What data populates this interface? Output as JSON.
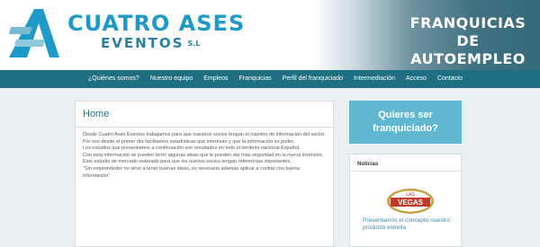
{
  "header": {
    "logo_main": "CUATRO ASES",
    "logo_sub": "EVENTOS",
    "logo_suffix": "S.L",
    "tagline_line1": "FRANQUICIAS DE",
    "tagline_line2": "AUTOEMPLEO"
  },
  "nav": {
    "items": [
      {
        "label": "¿Quiénes somos?"
      },
      {
        "label": "Nuestro equipo"
      },
      {
        "label": "Empleos"
      },
      {
        "label": "Franquicias"
      },
      {
        "label": "Perfil del franquiciado"
      },
      {
        "label": "Intermediación"
      },
      {
        "label": "Acceso"
      },
      {
        "label": "Contacto"
      }
    ]
  },
  "main": {
    "title": "Home",
    "paragraphs": [
      "Desde Cuatro Ases Eventos trabajamos para que nuestros socios tengan el máximo de información del sector.",
      "Por eso desde el primer día facilitamos estadísticas que interesan y que la información es poder.",
      "Los estudios que presentamos a continuación son resultados en todo el territorio nacional Español.",
      "Con esta información se pueden tener algunas ideas que le pueden dar más seguridad en la nueva inversión.",
      "Este estudio de mercado realizado para que los nuevos socios tengan referencias importantes.",
      "\"Sin emprendedor no sirve a tener buenas ideas, es necesario además aplicar a confiar con buena información\""
    ]
  },
  "sidebar": {
    "cta_line1": "Quieres ser",
    "cta_line2": "franquiciado?",
    "news_heading": "Noticias",
    "news_logo_text": "VEGAS",
    "news_logo_top": "LAS",
    "news_text": "Presentamos el concepto nuestro producto estrella"
  },
  "colors": {
    "brand_blue": "#1f9ac8",
    "nav_bg": "#1f6f82",
    "cta_bg": "#5fb8d0",
    "page_bg": "#eaf0f2"
  }
}
